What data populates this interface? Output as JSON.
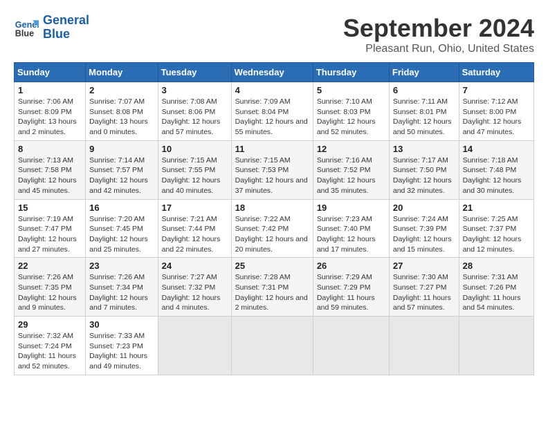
{
  "header": {
    "logo_line1": "General",
    "logo_line2": "Blue",
    "main_title": "September 2024",
    "subtitle": "Pleasant Run, Ohio, United States"
  },
  "calendar": {
    "days_of_week": [
      "Sunday",
      "Monday",
      "Tuesday",
      "Wednesday",
      "Thursday",
      "Friday",
      "Saturday"
    ],
    "weeks": [
      [
        {
          "day": "1",
          "sunrise": "7:06 AM",
          "sunset": "8:09 PM",
          "daylight": "13 hours and 2 minutes"
        },
        {
          "day": "2",
          "sunrise": "7:07 AM",
          "sunset": "8:08 PM",
          "daylight": "13 hours and 0 minutes"
        },
        {
          "day": "3",
          "sunrise": "7:08 AM",
          "sunset": "8:06 PM",
          "daylight": "12 hours and 57 minutes"
        },
        {
          "day": "4",
          "sunrise": "7:09 AM",
          "sunset": "8:04 PM",
          "daylight": "12 hours and 55 minutes"
        },
        {
          "day": "5",
          "sunrise": "7:10 AM",
          "sunset": "8:03 PM",
          "daylight": "12 hours and 52 minutes"
        },
        {
          "day": "6",
          "sunrise": "7:11 AM",
          "sunset": "8:01 PM",
          "daylight": "12 hours and 50 minutes"
        },
        {
          "day": "7",
          "sunrise": "7:12 AM",
          "sunset": "8:00 PM",
          "daylight": "12 hours and 47 minutes"
        }
      ],
      [
        {
          "day": "8",
          "sunrise": "7:13 AM",
          "sunset": "7:58 PM",
          "daylight": "12 hours and 45 minutes"
        },
        {
          "day": "9",
          "sunrise": "7:14 AM",
          "sunset": "7:57 PM",
          "daylight": "12 hours and 42 minutes"
        },
        {
          "day": "10",
          "sunrise": "7:15 AM",
          "sunset": "7:55 PM",
          "daylight": "12 hours and 40 minutes"
        },
        {
          "day": "11",
          "sunrise": "7:15 AM",
          "sunset": "7:53 PM",
          "daylight": "12 hours and 37 minutes"
        },
        {
          "day": "12",
          "sunrise": "7:16 AM",
          "sunset": "7:52 PM",
          "daylight": "12 hours and 35 minutes"
        },
        {
          "day": "13",
          "sunrise": "7:17 AM",
          "sunset": "7:50 PM",
          "daylight": "12 hours and 32 minutes"
        },
        {
          "day": "14",
          "sunrise": "7:18 AM",
          "sunset": "7:48 PM",
          "daylight": "12 hours and 30 minutes"
        }
      ],
      [
        {
          "day": "15",
          "sunrise": "7:19 AM",
          "sunset": "7:47 PM",
          "daylight": "12 hours and 27 minutes"
        },
        {
          "day": "16",
          "sunrise": "7:20 AM",
          "sunset": "7:45 PM",
          "daylight": "12 hours and 25 minutes"
        },
        {
          "day": "17",
          "sunrise": "7:21 AM",
          "sunset": "7:44 PM",
          "daylight": "12 hours and 22 minutes"
        },
        {
          "day": "18",
          "sunrise": "7:22 AM",
          "sunset": "7:42 PM",
          "daylight": "12 hours and 20 minutes"
        },
        {
          "day": "19",
          "sunrise": "7:23 AM",
          "sunset": "7:40 PM",
          "daylight": "12 hours and 17 minutes"
        },
        {
          "day": "20",
          "sunrise": "7:24 AM",
          "sunset": "7:39 PM",
          "daylight": "12 hours and 15 minutes"
        },
        {
          "day": "21",
          "sunrise": "7:25 AM",
          "sunset": "7:37 PM",
          "daylight": "12 hours and 12 minutes"
        }
      ],
      [
        {
          "day": "22",
          "sunrise": "7:26 AM",
          "sunset": "7:35 PM",
          "daylight": "12 hours and 9 minutes"
        },
        {
          "day": "23",
          "sunrise": "7:26 AM",
          "sunset": "7:34 PM",
          "daylight": "12 hours and 7 minutes"
        },
        {
          "day": "24",
          "sunrise": "7:27 AM",
          "sunset": "7:32 PM",
          "daylight": "12 hours and 4 minutes"
        },
        {
          "day": "25",
          "sunrise": "7:28 AM",
          "sunset": "7:31 PM",
          "daylight": "12 hours and 2 minutes"
        },
        {
          "day": "26",
          "sunrise": "7:29 AM",
          "sunset": "7:29 PM",
          "daylight": "11 hours and 59 minutes"
        },
        {
          "day": "27",
          "sunrise": "7:30 AM",
          "sunset": "7:27 PM",
          "daylight": "11 hours and 57 minutes"
        },
        {
          "day": "28",
          "sunrise": "7:31 AM",
          "sunset": "7:26 PM",
          "daylight": "11 hours and 54 minutes"
        }
      ],
      [
        {
          "day": "29",
          "sunrise": "7:32 AM",
          "sunset": "7:24 PM",
          "daylight": "11 hours and 52 minutes"
        },
        {
          "day": "30",
          "sunrise": "7:33 AM",
          "sunset": "7:23 PM",
          "daylight": "11 hours and 49 minutes"
        },
        null,
        null,
        null,
        null,
        null
      ]
    ]
  }
}
